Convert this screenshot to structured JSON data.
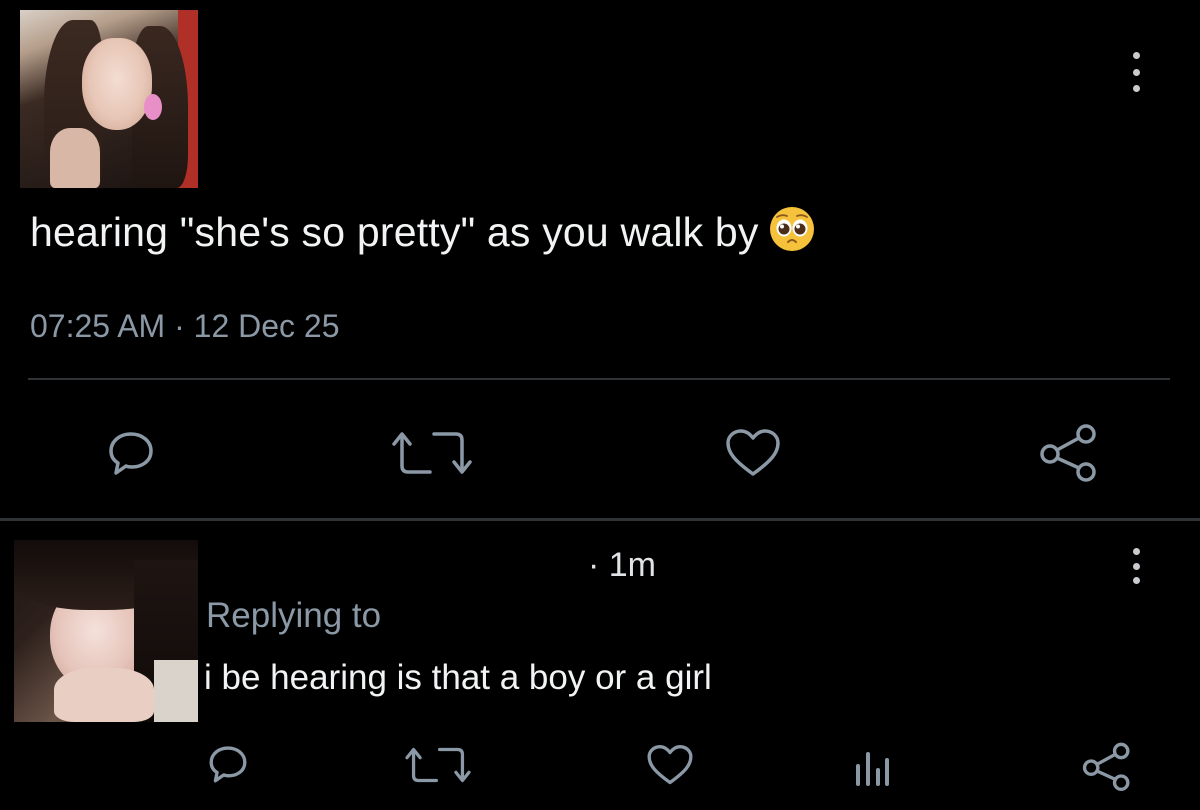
{
  "main_tweet": {
    "text": "hearing \"she's so pretty\" as you walk by",
    "emoji": "pleading-face-emoji",
    "timestamp": "07:25 AM · 12 Dec 25",
    "actions": [
      "reply-icon",
      "retweet-icon",
      "like-icon",
      "share-icon"
    ]
  },
  "reply": {
    "time": "· 1m",
    "replying_to": "Replying to",
    "text": "i be hearing is that a boy or a girl",
    "actions": [
      "reply-icon",
      "retweet-icon",
      "like-icon",
      "analytics-icon",
      "share-icon"
    ]
  },
  "colors": {
    "background": "#000000",
    "text": "#e7e9ea",
    "secondary": "#8b98a5",
    "divider": "#2f3336"
  }
}
